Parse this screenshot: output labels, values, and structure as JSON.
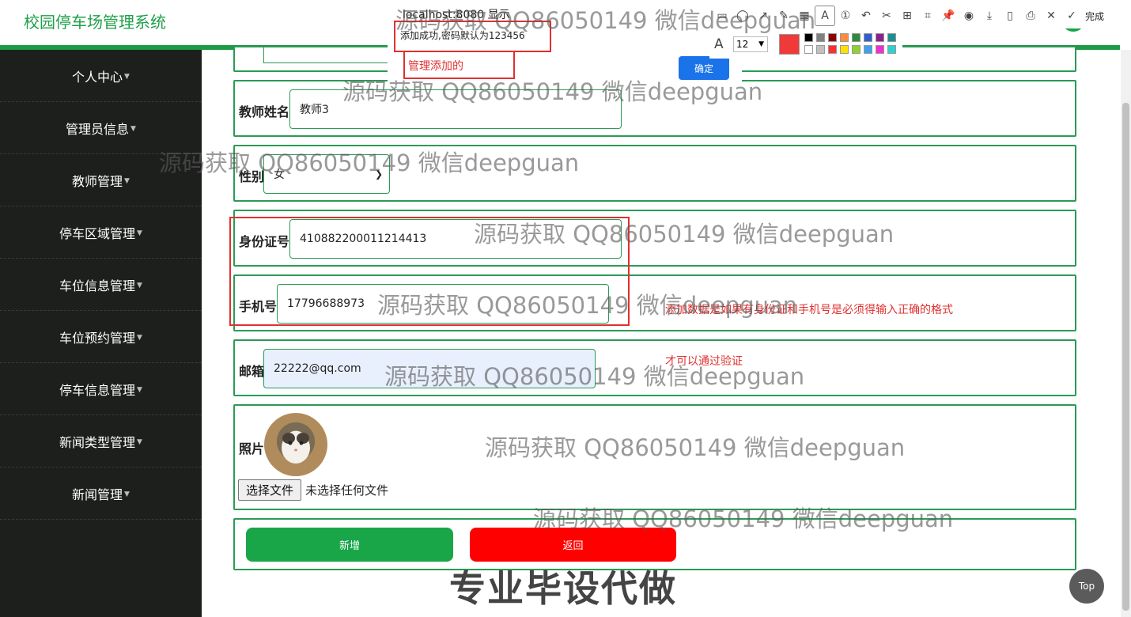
{
  "app": {
    "title": "校园停车场管理系统"
  },
  "sidebar": {
    "items": [
      {
        "label": "个人中心"
      },
      {
        "label": "管理员信息"
      },
      {
        "label": "教师管理"
      },
      {
        "label": "停车区域管理"
      },
      {
        "label": "车位信息管理"
      },
      {
        "label": "车位预约管理"
      },
      {
        "label": "停车信息管理"
      },
      {
        "label": "新闻类型管理"
      },
      {
        "label": "新闻管理"
      }
    ]
  },
  "form": {
    "teacher_name": {
      "label": "教师姓名",
      "value": "教师3"
    },
    "gender": {
      "label": "性别",
      "value": "女"
    },
    "id_card": {
      "label": "身份证号",
      "value": "410882200011214413"
    },
    "phone": {
      "label": "手机号",
      "value": "17796688973"
    },
    "email": {
      "label": "邮箱",
      "value": "22222@qq.com"
    },
    "photo": {
      "label": "照片",
      "file_button": "选择文件",
      "file_status": "未选择任何文件"
    },
    "add_button": "新增",
    "back_button": "返回"
  },
  "alert": {
    "title": "localhost:8080 显示",
    "message": "添加成功,密码默认为123456",
    "ok_button": "确定"
  },
  "annotations": {
    "admin_note": "管理添加的",
    "validation_note_1": "添加数据是如果有身份证和手机号是必须得输入正确的格式",
    "validation_note_2": "才可以通过验证"
  },
  "annotation_toolbar": {
    "font_size": "12",
    "done_label": "完成",
    "selected_color": "#f03a3a",
    "palette": [
      "#000000",
      "#808080",
      "#8b0000",
      "#ff8c3c",
      "#2e8b3c",
      "#3060d0",
      "#8b2090",
      "#1a9090",
      "#ffffff",
      "#c0c0c0",
      "#ff3030",
      "#ffe000",
      "#90d030",
      "#40a0f0",
      "#f030d0",
      "#30d0d0"
    ]
  },
  "watermark": {
    "text": "源码获取 QQ86050149 微信deepguan",
    "promo": "专业毕设代做"
  },
  "top_button": "Top"
}
